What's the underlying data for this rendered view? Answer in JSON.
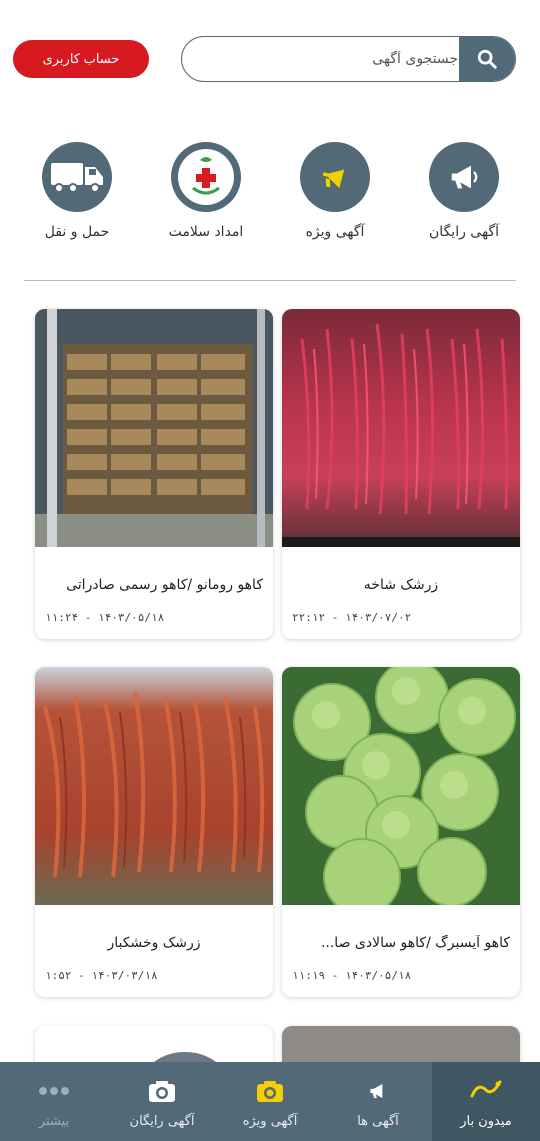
{
  "header": {
    "account_label": "حساب کاربری",
    "search_placeholder": "جستجوی آگهی"
  },
  "categories": [
    {
      "label": "آگهی رایگان",
      "icon": "megaphone-icon"
    },
    {
      "label": "آگهی ویژه",
      "icon": "megaphone-yellow-icon"
    },
    {
      "label": "امداد سلامت",
      "icon": "health-aid-icon"
    },
    {
      "label": "حمل و نقل",
      "icon": "truck-icon"
    }
  ],
  "listings": [
    {
      "title": "زرشک شاخه",
      "time": "۲۲:۱۲ - ۱۴۰۳/۰۷/۰۲",
      "image": "barberry-branches"
    },
    {
      "title": "کاهو رومانو /کاهو رسمی صادراتی",
      "time": "۱۱:۲۴ - ۱۴۰۳/۰۵/۱۸",
      "image": "lettuce-crates-truck"
    },
    {
      "title": "کاهو آیسبرگ /کاهو سالادی صا...",
      "time": "۱۱:۱۹ - ۱۴۰۳/۰۵/۱۸",
      "image": "iceberg-lettuce"
    },
    {
      "title": "زرشک وخشکبار",
      "time": "۱:۵۲ - ۱۴۰۳/۰۳/۱۸",
      "image": "dried-barberry-bush"
    }
  ],
  "bottom_nav": [
    {
      "label": "میدون بار",
      "icon": "logo-icon",
      "active": true
    },
    {
      "label": "آگهی ها",
      "icon": "megaphone-icon"
    },
    {
      "label": "آگهی ویژه",
      "icon": "camera-yellow-icon"
    },
    {
      "label": "آگهی رایگان",
      "icon": "camera-icon"
    },
    {
      "label": "بیشتر",
      "icon": "more-dots-icon"
    }
  ],
  "logo_text": "میدون بار",
  "colors": {
    "primary": "#526977",
    "accent_red": "#d71920",
    "accent_yellow": "#f3d000"
  }
}
